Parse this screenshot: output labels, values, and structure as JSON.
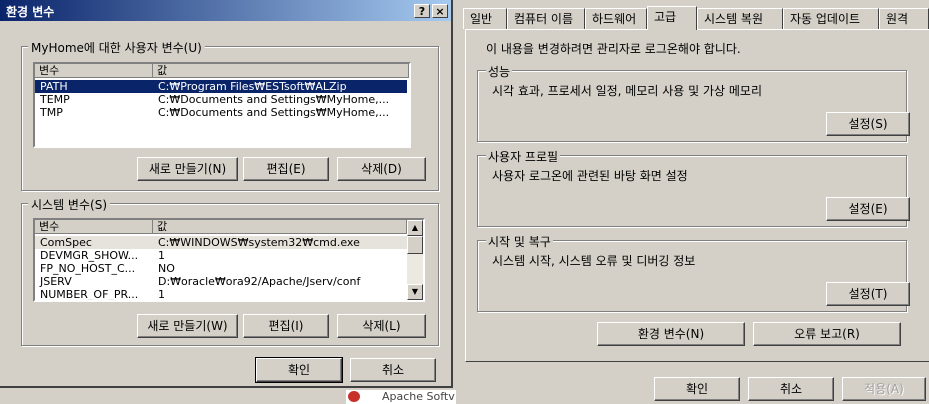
{
  "env_dialog": {
    "title": "환경 변수",
    "help_btn": "?",
    "close_btn": "×",
    "user_vars": {
      "group_label": "MyHome에 대한 사용자 변수(U)",
      "headers": [
        "변수",
        "값"
      ],
      "rows": [
        {
          "name": "PATH",
          "value": "C:₩Program Files₩ESTsoft₩ALZip"
        },
        {
          "name": "TEMP",
          "value": "C:₩Documents and Settings₩MyHome,..."
        },
        {
          "name": "TMP",
          "value": "C:₩Documents and Settings₩MyHome,..."
        }
      ],
      "new_label": "새로 만들기(N)",
      "edit_label": "편집(E)",
      "delete_label": "삭제(D)"
    },
    "sys_vars": {
      "group_label": "시스템 변수(S)",
      "headers": [
        "변수",
        "값"
      ],
      "rows": [
        {
          "name": "ComSpec",
          "value": "C:₩WINDOWS₩system32₩cmd.exe"
        },
        {
          "name": "DEVMGR_SHOW...",
          "value": "1"
        },
        {
          "name": "FP_NO_HOST_C...",
          "value": "NO"
        },
        {
          "name": "JSERV",
          "value": "D:₩oracle₩ora92/Apache/Jserv/conf"
        },
        {
          "name": "NUMBER_OF_PR...",
          "value": "1"
        }
      ],
      "new_label": "새로 만들기(W)",
      "edit_label": "편집(I)",
      "delete_label": "삭제(L)"
    },
    "ok_label": "확인",
    "cancel_label": "취소"
  },
  "sys_dialog": {
    "tabs": [
      "일반",
      "컴퓨터 이름",
      "하드웨어",
      "고급",
      "시스템 복원",
      "자동 업데이트",
      "원격"
    ],
    "active_tab": "고급",
    "admin_notice": "이 내용을 변경하려면 관리자로 로그온해야 합니다.",
    "sections": [
      {
        "label": "성능",
        "desc": "시각 효과, 프로세서 일정, 메모리 사용 및 가상 메모리",
        "button": "설정(S)"
      },
      {
        "label": "사용자 프로필",
        "desc": "사용자 로그온에 관련된 바탕 화면 설정",
        "button": "설정(E)"
      },
      {
        "label": "시작 및 복구",
        "desc": "시스템 시작, 시스템 오류 및 디버깅 정보",
        "button": "설정(T)"
      }
    ],
    "env_vars_label": "환경 변수(N)",
    "error_report_label": "오류 보고(R)",
    "ok_label": "확인",
    "cancel_label": "취소",
    "apply_label": "적용(A)"
  },
  "background": {
    "app_text": "Apache Softv"
  },
  "colors": {
    "face": "#d4d0c8",
    "title_start": "#0a246a",
    "title_end": "#a6caf0",
    "selection": "#0a246a"
  }
}
